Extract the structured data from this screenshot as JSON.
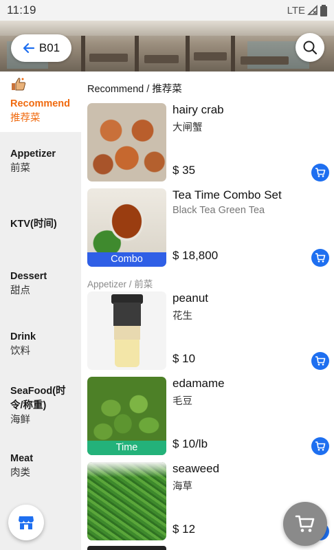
{
  "status_bar": {
    "time": "11:19",
    "network": "LTE"
  },
  "header": {
    "table_label": "B01"
  },
  "sidebar": {
    "items": [
      {
        "en": "Recommend",
        "zh": "推荐菜",
        "active": true
      },
      {
        "en": "Appetizer",
        "zh": "前菜"
      },
      {
        "en": "KTV(时间)",
        "zh": ""
      },
      {
        "en": "Dessert",
        "zh": "甜点"
      },
      {
        "en": "Drink",
        "zh": "饮料"
      },
      {
        "en": "SeaFood(时令/称重)",
        "zh": "海鲜"
      },
      {
        "en": "Meat",
        "zh": "肉类"
      }
    ]
  },
  "sections": {
    "recommend": "Recommend / 推荐菜",
    "appetizer": "Appetizer / 前菜"
  },
  "dishes": [
    {
      "name": "hairy crab",
      "sub": "大闸蟹",
      "price": "$ 35",
      "tag": ""
    },
    {
      "name": "Tea Time Combo Set",
      "sub": "Black Tea Green Tea",
      "price": "$ 18,800",
      "tag": "Combo"
    },
    {
      "name": "peanut",
      "sub": "花生",
      "price": "$ 10",
      "tag": ""
    },
    {
      "name": "edamame",
      "sub": "毛豆",
      "price": "$ 10/lb",
      "tag": "Time"
    },
    {
      "name": "seaweed",
      "sub": "海草",
      "price": "$ 12",
      "tag": ""
    }
  ],
  "colors": {
    "accent_orange": "#f06a0f",
    "cart_blue": "#1e6ff0",
    "combo_tag": "#2f5fe6",
    "time_tag": "#23b27a"
  },
  "icons": {
    "back": "arrow-left-icon",
    "search": "search-icon",
    "recommend": "thumbs-up-icon",
    "add_to_cart": "cart-icon",
    "store": "store-icon",
    "cart": "cart-icon"
  }
}
